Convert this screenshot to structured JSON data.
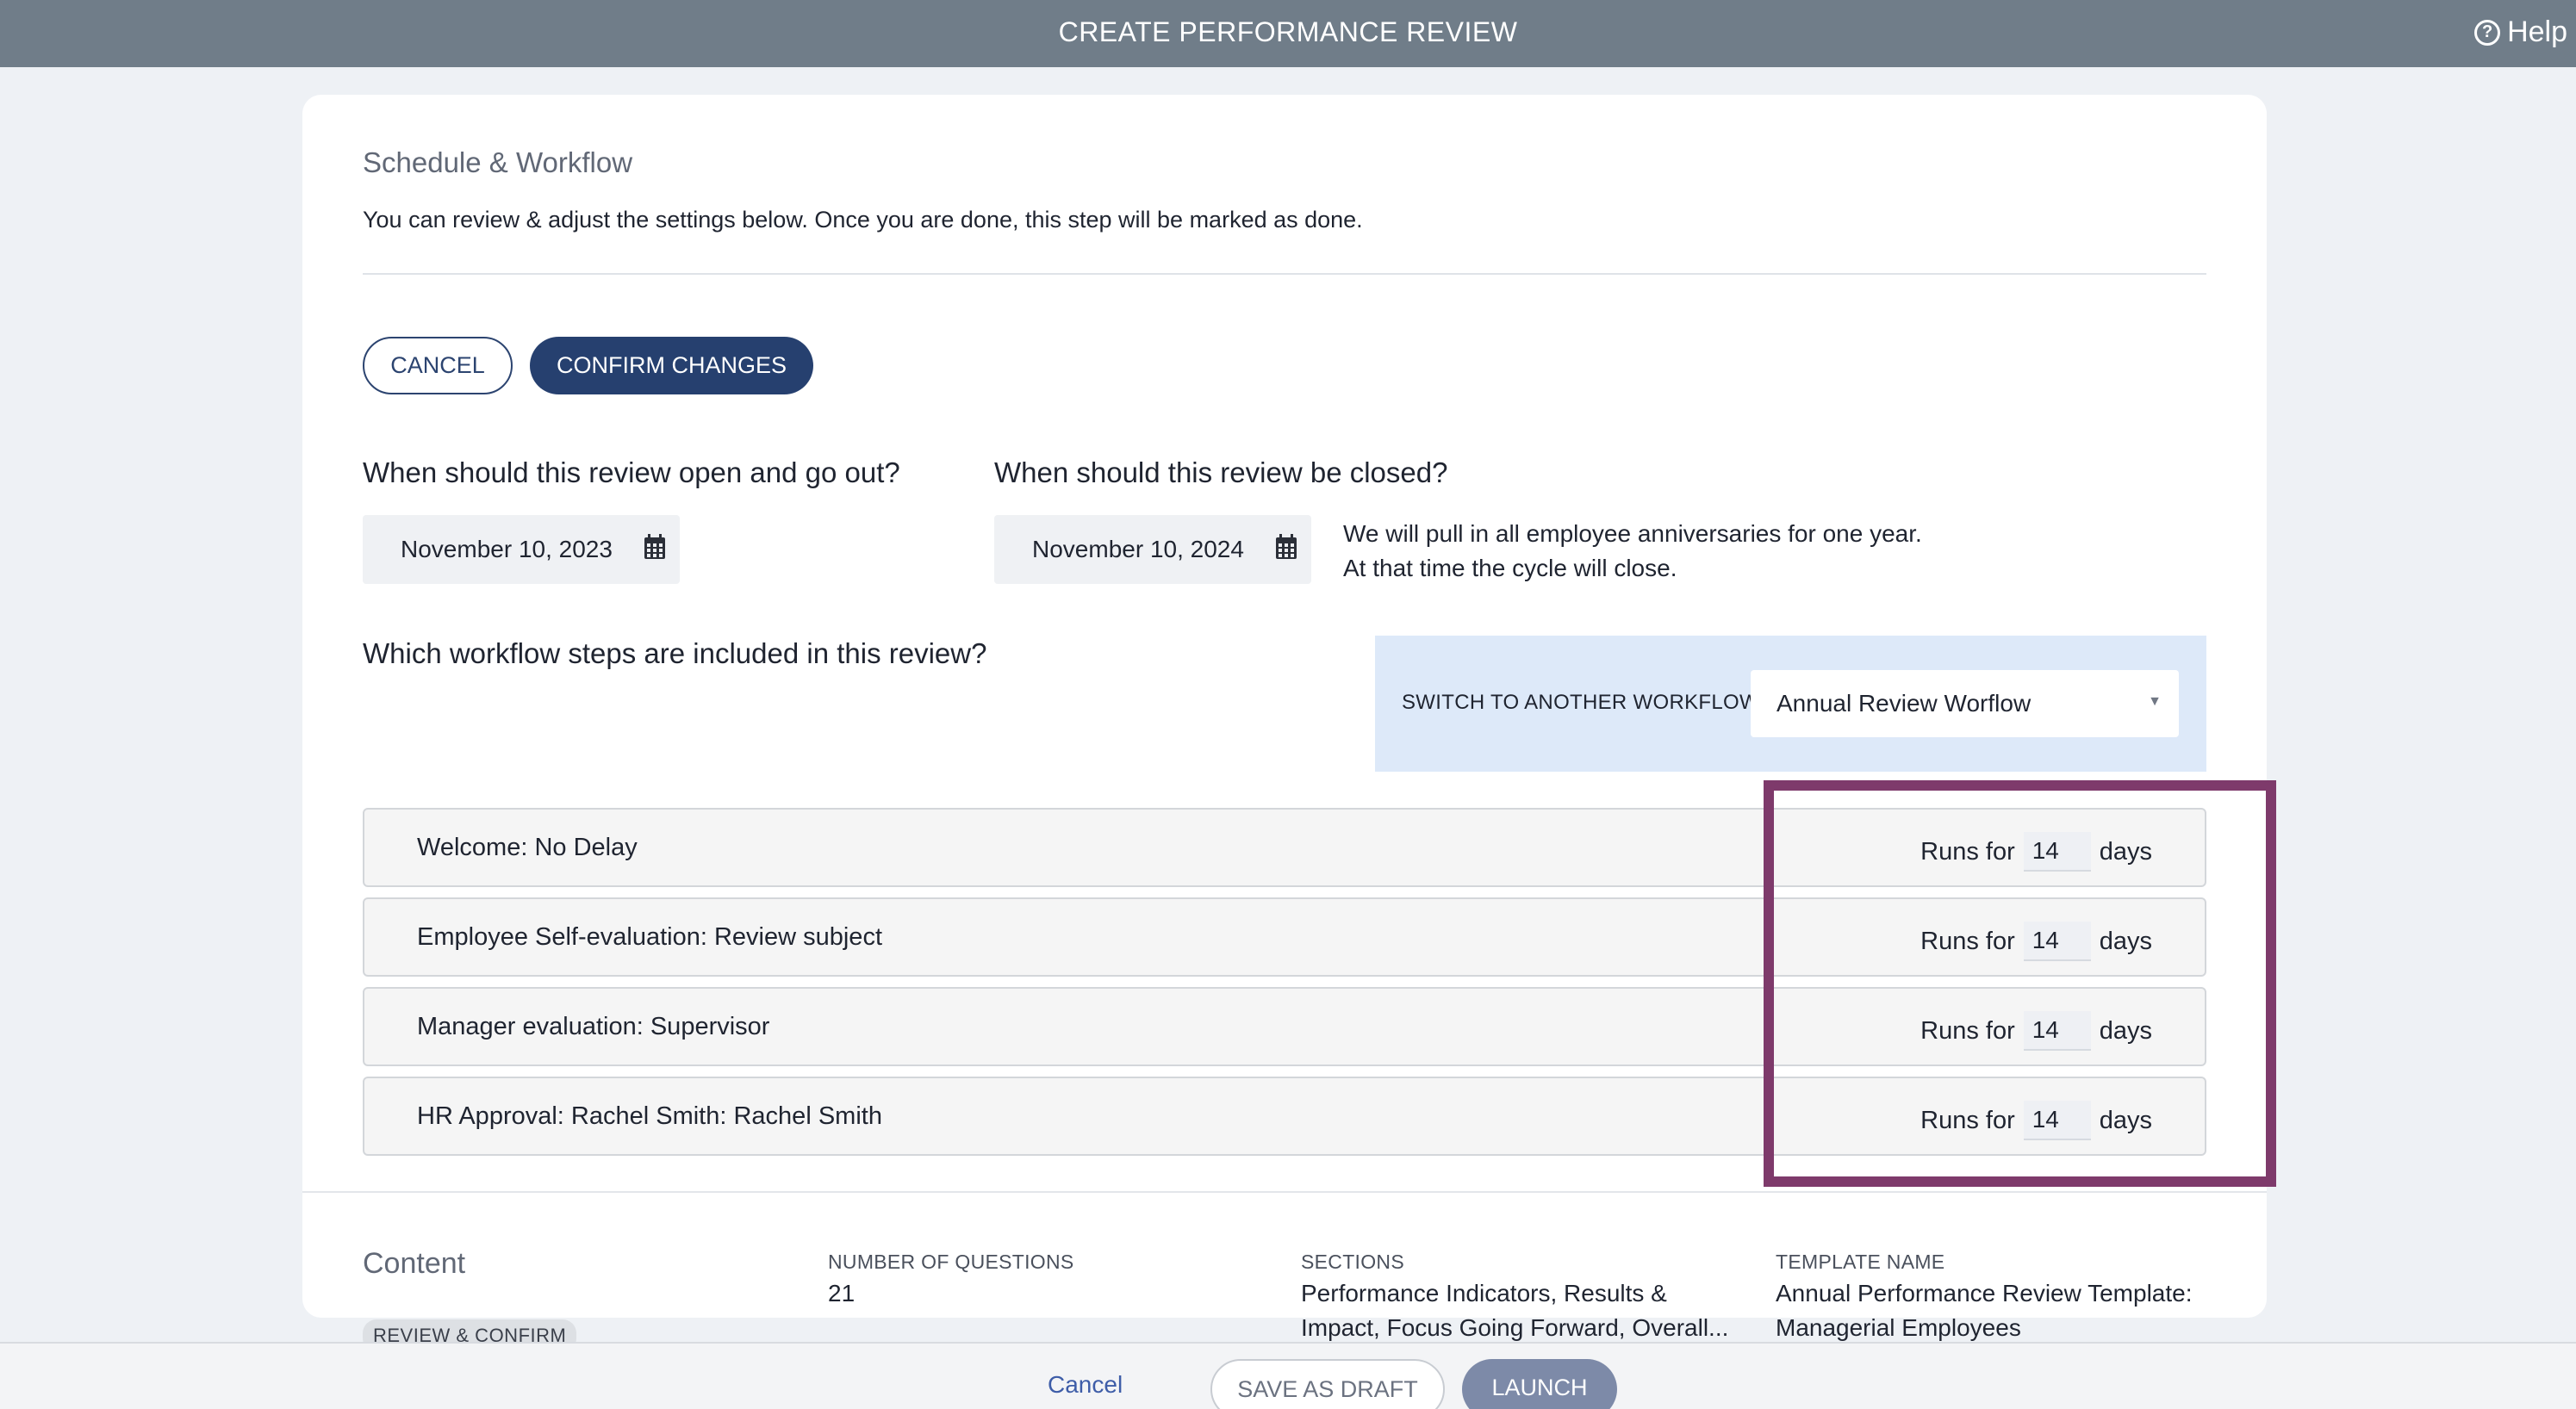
{
  "header": {
    "title": "CREATE PERFORMANCE REVIEW",
    "help_label": "Help"
  },
  "schedule": {
    "title": "Schedule & Workflow",
    "description": "You can review & adjust the settings below. Once you are done, this step will be marked as done.",
    "cancel_label": "CANCEL",
    "confirm_label": "CONFIRM CHANGES",
    "open_question": "When should this review open and go out?",
    "open_date": "November 10, 2023",
    "close_question": "When should this review be closed?",
    "close_date": "November 10, 2024",
    "note_line1": "We will pull in all employee anniversaries for one year.",
    "note_line2": "At that time the cycle will close.",
    "workflow_question": "Which workflow steps are included in this review?",
    "switch_label": "SWITCH TO ANOTHER WORKFLOW",
    "workflow_selected": "Annual Review Worflow",
    "steps": [
      {
        "name": "Welcome: No Delay",
        "runs_label": "Runs for",
        "days": "14",
        "days_label": "days"
      },
      {
        "name": "Employee Self-evaluation: Review subject",
        "runs_label": "Runs for",
        "days": "14",
        "days_label": "days"
      },
      {
        "name": "Manager evaluation: Supervisor",
        "runs_label": "Runs for",
        "days": "14",
        "days_label": "days"
      },
      {
        "name": "HR Approval: Rachel Smith: Rachel Smith",
        "runs_label": "Runs for",
        "days": "14",
        "days_label": "days"
      }
    ]
  },
  "content": {
    "title": "Content",
    "badge": "REVIEW & CONFIRM",
    "num_questions_label": "NUMBER OF QUESTIONS",
    "num_questions": "21",
    "sections_label": "SECTIONS",
    "sections_line1": "Performance Indicators, Results &",
    "sections_line2": "Impact, Focus Going Forward, Overall...",
    "template_label": "TEMPLATE NAME",
    "template_line1": "Annual Performance Review Template:",
    "template_line2": "Managerial Employees"
  },
  "footer": {
    "cancel_label": "Cancel",
    "draft_label": "SAVE AS DRAFT",
    "launch_label": "LAUNCH"
  },
  "colors": {
    "header_bg": "#707d89",
    "primary": "#26406f",
    "highlight": "#7e3a6b",
    "workflow_panel": "#dde9f9"
  }
}
